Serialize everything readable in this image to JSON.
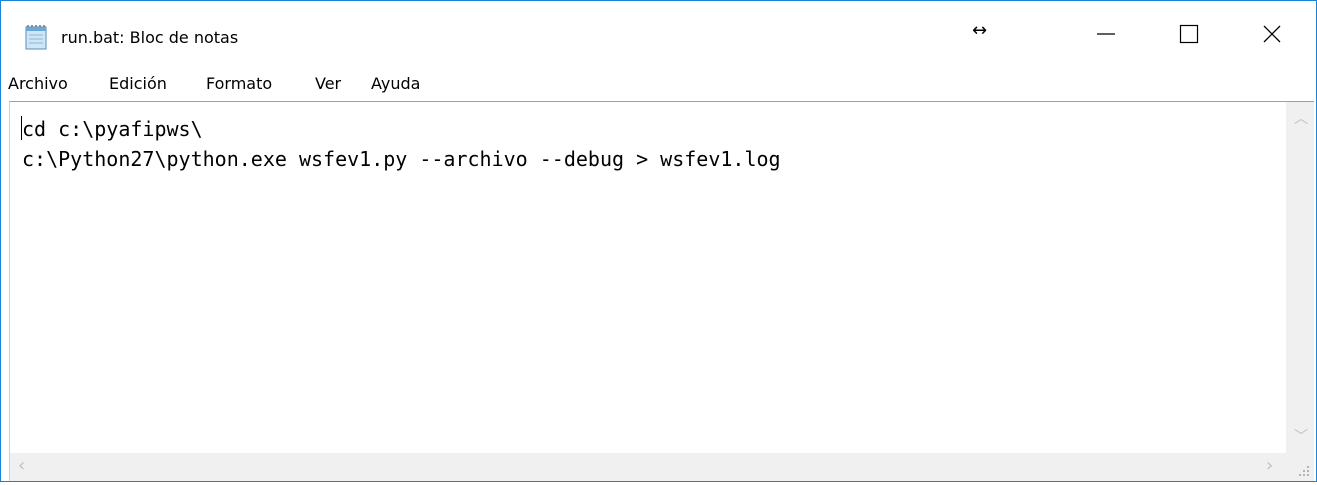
{
  "window": {
    "title": "run.bat: Bloc de notas",
    "resize_glyph": "↔",
    "accent_color": "#1883d7"
  },
  "icons": {
    "app": "notepad-icon",
    "resize": "horizontal-resize-icon",
    "minimize": "minimize-icon",
    "maximize": "maximize-icon",
    "close": "close-icon"
  },
  "menubar": {
    "items": [
      {
        "label": "Archivo"
      },
      {
        "label": "Edición"
      },
      {
        "label": "Formato"
      },
      {
        "label": "Ver"
      },
      {
        "label": "Ayuda"
      }
    ]
  },
  "editor": {
    "lines": [
      "cd c:\\pyafipws\\",
      "c:\\Python27\\python.exe wsfev1.py --archivo --debug > wsfev1.log"
    ]
  }
}
